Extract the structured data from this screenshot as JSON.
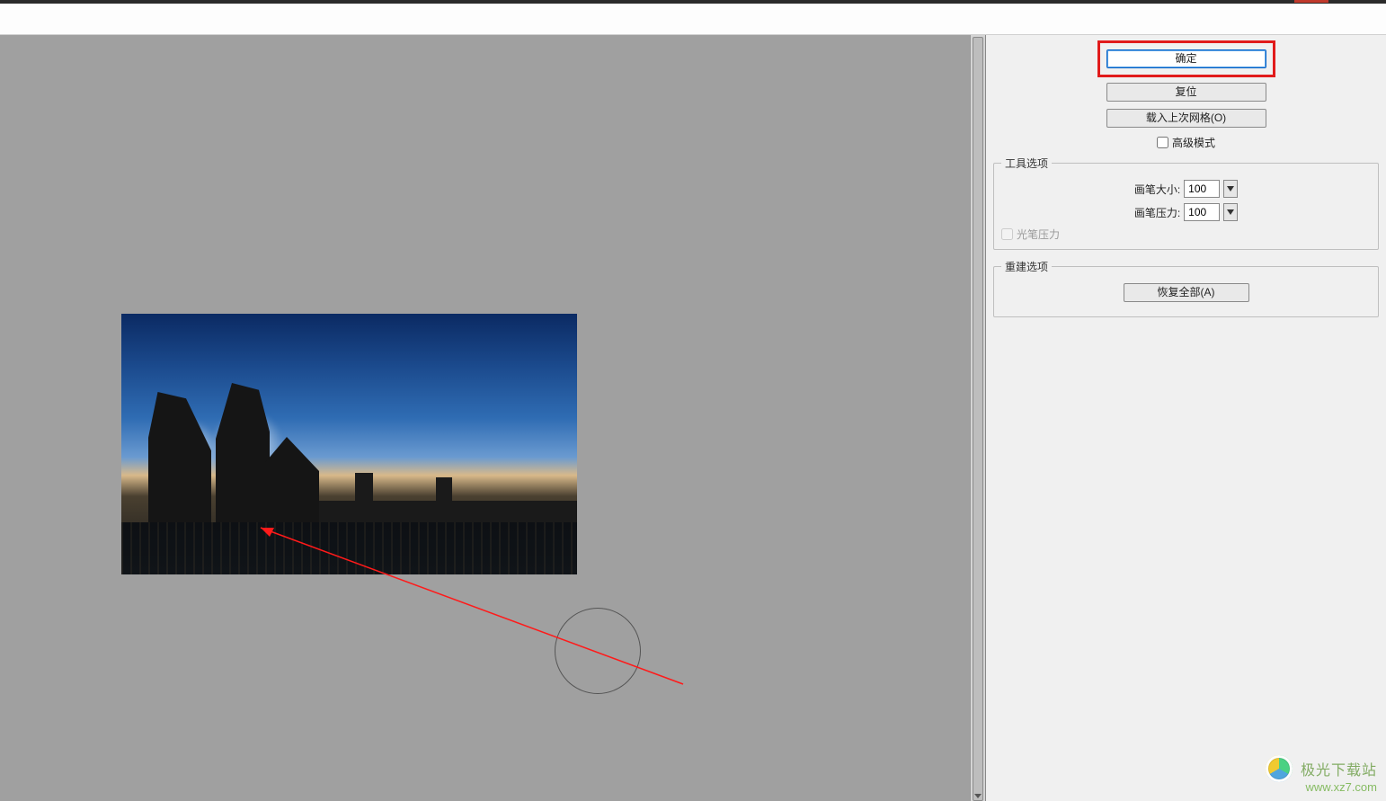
{
  "panel": {
    "ok_label": "确定",
    "reset_label": "复位",
    "load_mesh_label": "载入上次网格(O)",
    "advanced_mode_label": "高级模式",
    "tool_options_legend": "工具选项",
    "brush_size_label": "画笔大小:",
    "brush_size_value": "100",
    "brush_pressure_label": "画笔压力:",
    "brush_pressure_value": "100",
    "stylus_pressure_label": "光笔压力",
    "rebuild_options_legend": "重建选项",
    "restore_all_label": "恢复全部(A)"
  },
  "watermark": {
    "text": "极光下载站",
    "url": "www.xz7.com"
  }
}
